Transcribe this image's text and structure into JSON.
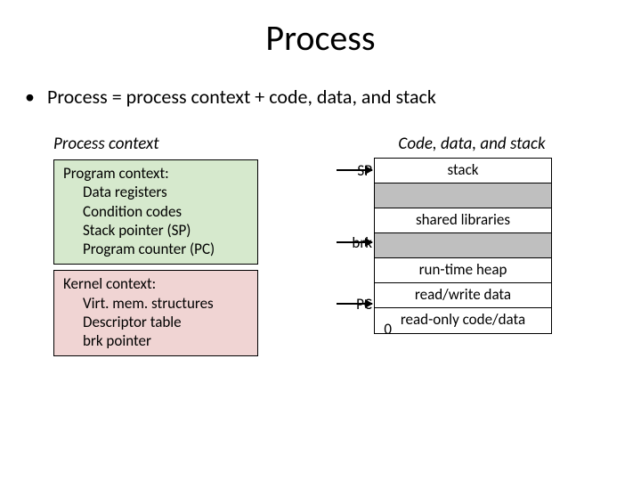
{
  "title": "Process",
  "bullet": "Process = process context + code, data, and stack",
  "left_heading": "Process context",
  "right_heading": "Code, data, and stack",
  "program_ctx": {
    "title": "Program context:",
    "items": [
      "Data registers",
      "Condition codes",
      "Stack pointer (SP)",
      "Program counter (PC)"
    ]
  },
  "kernel_ctx": {
    "title": "Kernel context:",
    "items": [
      "Virt. mem. structures",
      "Descriptor table",
      "brk pointer"
    ]
  },
  "memory": {
    "segments": [
      "stack",
      "",
      "shared libraries",
      "",
      "run-time heap",
      "read/write data",
      "read-only code/data"
    ],
    "pointers": {
      "sp": "SP",
      "brk": "brk",
      "pc": "PC",
      "bottom": "0"
    }
  }
}
